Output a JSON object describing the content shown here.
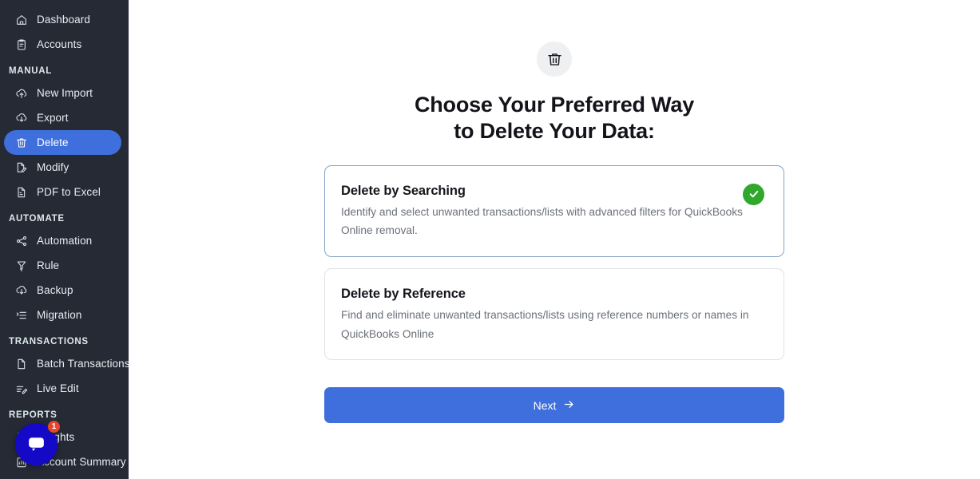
{
  "sidebar": {
    "background_color": "#252a35",
    "active_color": "#3f6fdc",
    "groups": [
      {
        "label": null,
        "items": [
          {
            "label": "Dashboard",
            "icon": "home-icon",
            "active": false
          },
          {
            "label": "Accounts",
            "icon": "clipboard-icon",
            "active": false
          }
        ]
      },
      {
        "label": "MANUAL",
        "items": [
          {
            "label": "New Import",
            "icon": "upload-cloud-icon",
            "active": false
          },
          {
            "label": "Export",
            "icon": "download-cloud-icon",
            "active": false
          },
          {
            "label": "Delete",
            "icon": "trash-icon",
            "active": true
          },
          {
            "label": "Modify",
            "icon": "file-pencil-icon",
            "active": false
          },
          {
            "label": "PDF to Excel",
            "icon": "pdf-file-icon",
            "active": false
          }
        ]
      },
      {
        "label": "AUTOMATE",
        "items": [
          {
            "label": "Automation",
            "icon": "share-nodes-icon",
            "active": false
          },
          {
            "label": "Rule",
            "icon": "funnel-icon",
            "active": false
          },
          {
            "label": "Backup",
            "icon": "download-cloud-icon",
            "active": false
          },
          {
            "label": "Migration",
            "icon": "list-arrow-icon",
            "active": false
          }
        ]
      },
      {
        "label": "TRANSACTIONS",
        "items": [
          {
            "label": "Batch Transactions",
            "icon": "document-icon",
            "active": false
          },
          {
            "label": "Live Edit",
            "icon": "list-pencil-icon",
            "active": false
          }
        ]
      },
      {
        "label": "REPORTS",
        "items": [
          {
            "label": "Insights",
            "icon": "sliders-icon",
            "active": false
          },
          {
            "label": "Account Summary",
            "icon": "report-icon",
            "active": false
          }
        ]
      }
    ]
  },
  "chat": {
    "icon": "chat-bubble-icon",
    "badge_count": "1",
    "bubble_color": "#1409c6",
    "badge_color": "#e8462a"
  },
  "main": {
    "hero_icon": "trash-icon",
    "title_line_1": "Choose Your Preferred Way",
    "title_line_2": "to Delete Your Data:",
    "options": [
      {
        "title": "Delete by Searching",
        "description": "Identify and select unwanted transactions/lists with advanced filters for QuickBooks Online removal.",
        "selected": true,
        "check_color": "#2fa82b"
      },
      {
        "title": "Delete by Reference",
        "description": "Find and eliminate unwanted transactions/lists using reference numbers or names in QuickBooks Online",
        "selected": false,
        "check_color": null
      }
    ],
    "next_label": "Next",
    "next_icon": "arrow-right-icon",
    "next_color": "#3f6fdc"
  }
}
